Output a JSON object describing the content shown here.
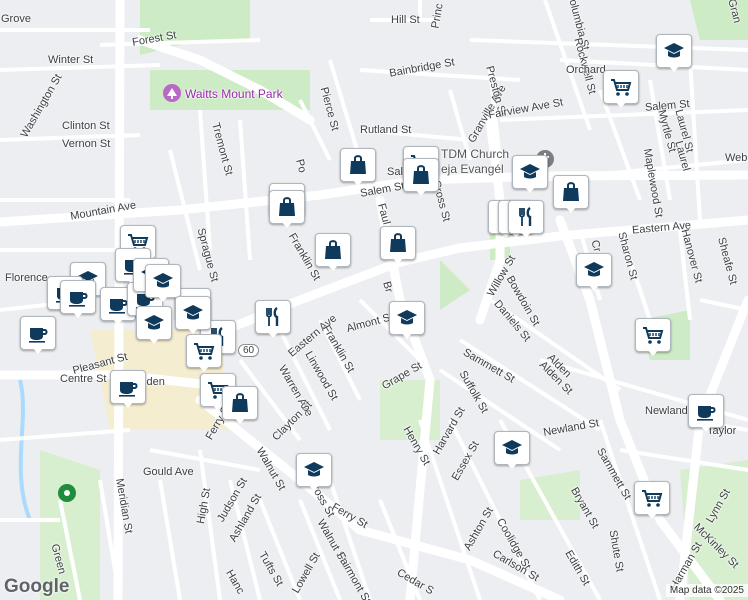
{
  "map": {
    "colors": {
      "background": "#eceef1",
      "road": "#ffffff",
      "major_road": "#ffffff",
      "park": "#cdebc4",
      "water": "#aadaff",
      "pin_icon": "#0f3a5c",
      "poi": "#9c27b0",
      "downtown": "#f5edd0"
    },
    "street_labels": [
      "Hill St",
      "Princ",
      "Forest St",
      "Winter St",
      "Grove",
      "Washington St",
      "Clinton St",
      "Vernon St",
      "Bainbridge St",
      "Pierce St",
      "Rutland St",
      "Granville Ave",
      "Preston St",
      "Fairview Ave St",
      "Columbia St",
      "Rockwell St",
      "Orchard",
      "Salem St",
      "Salem St",
      "Salem St",
      "Myrtle St",
      "Laurel St",
      "Maplewood St",
      "Webst",
      "Tremont St",
      "Mountain Ave",
      "Sprague St",
      "Franklin St",
      "Faul",
      "Cross St",
      "Eastern Ave",
      "Eastern Ave",
      "Willow St",
      "Bowdoin St",
      "Daniels St",
      "Sharon St",
      "Hanover St",
      "Sheafe St",
      "Florence",
      "Pleasant St",
      "Centre St",
      "Almont St",
      "Franklin St",
      "Linwood St",
      "Warren Ave",
      "Clayton St",
      "Grape St",
      "Sammett St",
      "Suffolk St",
      "Alden St",
      "Newland St",
      "Taylor",
      "Henry St",
      "Harvard St",
      "Essex St",
      "Newland St",
      "Sammett St",
      "Bryant St",
      "Lynn St",
      "Gould Ave",
      "Walnut St",
      "Cross St",
      "Ferry St",
      "Ferry St",
      "Judson St",
      "High St",
      "Meridian St",
      "Ashland St",
      "Walnut St",
      "Lowell St",
      "Tufts St",
      "Fairmont St",
      "Ashton St",
      "Coolidge St",
      "Carlson St",
      "Edith St",
      "Shute St",
      "McKinley St",
      "Harman St",
      "Cedar S",
      "Hanc",
      "Green",
      "Maple",
      "Cr",
      "Br",
      "Po",
      "Gran",
      "Laurel",
      "Alden",
      "alden"
    ],
    "poi": {
      "park_name": "Waitts Mount Park",
      "church_line1": "TDM Church",
      "church_line2": "eja Evangél"
    },
    "pins": [
      {
        "icon": "school-icon"
      },
      {
        "icon": "grocery-cart-icon"
      },
      {
        "icon": "shopping-bag-icon"
      },
      {
        "icon": "grocery-cart-icon"
      },
      {
        "icon": "shopping-bag-icon"
      },
      {
        "icon": "school-icon"
      },
      {
        "icon": "shopping-bag-icon"
      },
      {
        "icon": "restaurant-icon"
      },
      {
        "icon": "restaurant-icon"
      },
      {
        "icon": "restaurant-icon"
      },
      {
        "icon": "shopping-bag-icon"
      },
      {
        "icon": "shopping-bag-icon"
      },
      {
        "icon": "shopping-bag-icon"
      },
      {
        "icon": "shopping-bag-icon"
      },
      {
        "icon": "school-icon"
      },
      {
        "icon": "grocery-cart-icon"
      },
      {
        "icon": "coffee-icon"
      },
      {
        "icon": "school-icon"
      },
      {
        "icon": "coffee-icon"
      },
      {
        "icon": "coffee-icon"
      },
      {
        "icon": "coffee-icon"
      },
      {
        "icon": "coffee-icon"
      },
      {
        "icon": "school-icon"
      },
      {
        "icon": "school-icon"
      },
      {
        "icon": "restaurant-icon"
      },
      {
        "icon": "restaurant-icon"
      },
      {
        "icon": "grocery-cart-icon"
      },
      {
        "icon": "school-icon"
      },
      {
        "icon": "coffee-icon"
      },
      {
        "icon": "grocery-cart-icon"
      },
      {
        "icon": "shopping-bag-icon"
      },
      {
        "icon": "grocery-cart-icon"
      },
      {
        "icon": "coffee-icon"
      },
      {
        "icon": "school-icon"
      },
      {
        "icon": "school-icon"
      },
      {
        "icon": "grocery-cart-icon"
      },
      {
        "icon": "school-icon"
      },
      {
        "icon": "school-icon"
      },
      {
        "icon": "coffee-icon"
      },
      {
        "icon": "school-icon"
      }
    ],
    "route_shield": "60",
    "footer": {
      "logo": "Google",
      "attribution": "Map data ©2025"
    }
  }
}
